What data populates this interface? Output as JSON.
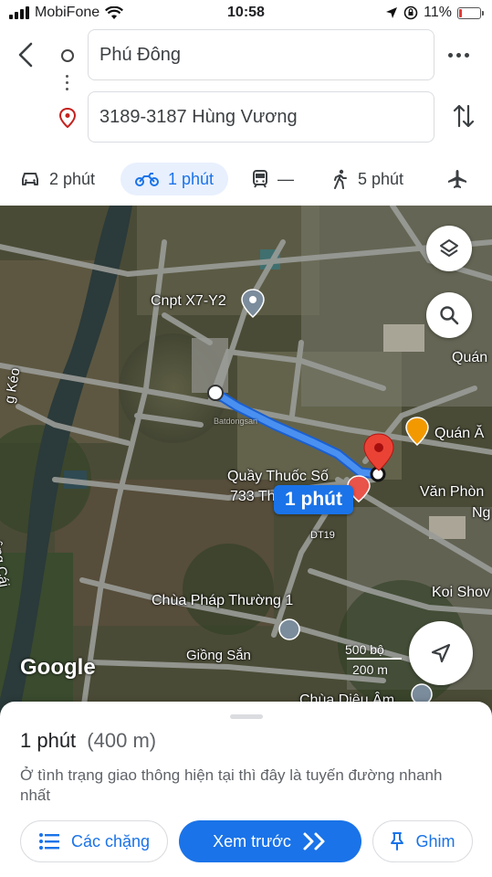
{
  "status_bar": {
    "carrier": "MobiFone",
    "time": "10:58",
    "battery": "11%"
  },
  "route": {
    "origin": "Phú Đông",
    "destination": "3189-3187 Hùng Vương"
  },
  "modes": [
    {
      "icon": "car-icon",
      "label": "2 phút"
    },
    {
      "icon": "motorbike-icon",
      "label": "1 phút",
      "active": true
    },
    {
      "icon": "transit-icon",
      "label": "—"
    },
    {
      "icon": "walk-icon",
      "label": "5 phút"
    },
    {
      "icon": "flight-icon",
      "label": ""
    }
  ],
  "map": {
    "labels": {
      "cnpt": "Cnpt X7-Y2",
      "quan_top": "Quán",
      "quan_an": "Quán Ă",
      "quay_thuoc_1": "Quầy Thuốc Số",
      "quay_thuoc_2": "733 Th",
      "van_phong_1": "Văn Phòn",
      "van_phong_2": "Ng",
      "dt19": "DT19",
      "koi": "Koi Shov",
      "chua_phap": "Chùa Pháp Thường 1",
      "giong_san": "Giồng Sắn",
      "chua_dieu": "Chùa Diệu Âm",
      "g_keo": "g Kéo",
      "ong_cai": "ông Cái",
      "watermark": "Batdongsan"
    },
    "route_badge": "1 phút",
    "scale": {
      "top": "500 bộ",
      "bottom": "200 m"
    },
    "logo": "Google"
  },
  "sheet": {
    "time": "1 phút",
    "distance": "(400 m)",
    "description": "Ở tình trạng giao thông hiện tại thì đây là tuyến đường nhanh nhất",
    "buttons": {
      "steps": "Các chặng",
      "preview": "Xem trước",
      "pin": "Ghim"
    }
  },
  "colors": {
    "accent": "#1a73e8",
    "route_line": "#4285f4",
    "pin": "#ea4335"
  }
}
